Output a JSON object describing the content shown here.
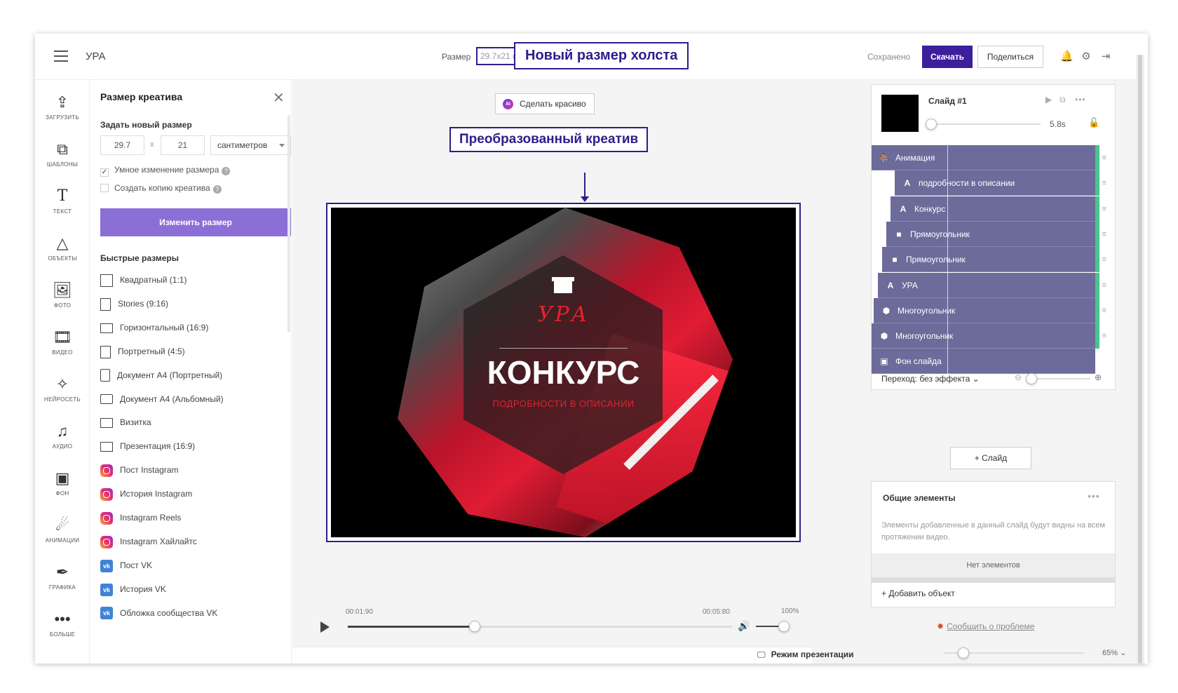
{
  "header": {
    "app_name": "УРА",
    "size_label": "Размер",
    "size_value": "29.7x21 cm",
    "saved": "Сохранено",
    "download": "Скачать",
    "share": "Поделиться",
    "icons": [
      "bell-icon",
      "gear-icon",
      "exit-icon"
    ]
  },
  "annotations": {
    "new_canvas_size": "Новый размер холста",
    "transformed_creative": "Преобразованный креатив",
    "color": "#2d1d8c"
  },
  "toolbar": {
    "items": [
      {
        "label": "ЗАГРУЗИТЬ",
        "icon": "upload-icon"
      },
      {
        "label": "ШАБЛОНЫ",
        "icon": "templates-icon"
      },
      {
        "label": "ТЕКСТ",
        "icon": "text-icon"
      },
      {
        "label": "ОБЪЕКТЫ",
        "icon": "shapes-icon"
      },
      {
        "label": "ФОТО",
        "icon": "photo-icon"
      },
      {
        "label": "ВИДЕО",
        "icon": "video-icon"
      },
      {
        "label": "НЕЙРОСЕТЬ",
        "icon": "magic-wand-icon"
      },
      {
        "label": "АУДИО",
        "icon": "music-icon"
      },
      {
        "label": "ФОН",
        "icon": "background-icon"
      },
      {
        "label": "АНИМАЦИИ",
        "icon": "animation-icon"
      },
      {
        "label": "ГРАФИКА",
        "icon": "brush-icon"
      },
      {
        "label": "БОЛЬШЕ",
        "icon": "more-icon"
      }
    ]
  },
  "size_panel": {
    "title": "Размер креатива",
    "subtitle": "Задать новый размер",
    "width": "29.7",
    "times": "x",
    "height": "21",
    "unit": "сантиметров",
    "smart_resize": "Умное изменение размера",
    "make_copy": "Создать копию креатива",
    "resize_button": "Изменить размер",
    "quick_title": "Быстрые размеры",
    "quick_sizes": [
      {
        "label": "Квадратный (1:1)",
        "icon": "square"
      },
      {
        "label": "Stories (9:16)",
        "icon": "portrait"
      },
      {
        "label": "Горизонтальный (16:9)",
        "icon": "landscape"
      },
      {
        "label": "Портретный (4:5)",
        "icon": "portrait"
      },
      {
        "label": "Документ А4 (Портретный)",
        "icon": "doc"
      },
      {
        "label": "Документ А4 (Альбомный)",
        "icon": "doc-land"
      },
      {
        "label": "Визитка",
        "icon": "card"
      },
      {
        "label": "Презентация (16:9)",
        "icon": "presentation"
      },
      {
        "label": "Пост Instagram",
        "icon": "instagram"
      },
      {
        "label": "История Instagram",
        "icon": "instagram"
      },
      {
        "label": "Instagram Reels",
        "icon": "instagram"
      },
      {
        "label": "Instagram Хайлайтс",
        "icon": "instagram"
      },
      {
        "label": "Пост VK",
        "icon": "vk"
      },
      {
        "label": "История VK",
        "icon": "vk"
      },
      {
        "label": "Обложка сообщества VK",
        "icon": "vk"
      }
    ]
  },
  "canvas": {
    "beautify_button": "Сделать красиво",
    "ai_badge": "AI",
    "logo_text": "УРА",
    "title": "КОНКУРС",
    "subtitle": "ПОДРОБНОСТИ В ОПИСАНИИ"
  },
  "playback": {
    "current_time": "00:01:90",
    "total_time": "00:05:80",
    "volume": "100%",
    "progress": 0.33,
    "presentation_mode": "Режим презентации",
    "zoom": "65% ⌄"
  },
  "slide": {
    "name": "Слайд #1",
    "duration": "5.8s",
    "layers": [
      {
        "label": "Анимация",
        "icon": "run-icon",
        "glyph": "⛹"
      },
      {
        "label": "подробности в описании",
        "icon": "text-layer-icon",
        "glyph": "A"
      },
      {
        "label": "Конкурс",
        "icon": "text-layer-icon",
        "glyph": "A"
      },
      {
        "label": "Прямоугольник",
        "icon": "rectangle-icon",
        "glyph": "■"
      },
      {
        "label": "Прямоугольник",
        "icon": "rectangle-icon",
        "glyph": "■"
      },
      {
        "label": "УРА",
        "icon": "text-layer-icon",
        "glyph": "A"
      },
      {
        "label": "Многоугольник",
        "icon": "polygon-icon",
        "glyph": "⬢"
      },
      {
        "label": "Многоугольник",
        "icon": "polygon-icon",
        "glyph": "⬢"
      },
      {
        "label": "Фон слайда",
        "icon": "background-layer-icon",
        "glyph": "▣"
      }
    ],
    "transition": "Переход: без эффекта ⌄"
  },
  "right": {
    "add_slide": "+ Слайд",
    "common_title": "Общие элементы",
    "common_desc": "Элементы добавленные в данный слайд будут видны на всем протяжении видео.",
    "no_elements": "Нет элементов",
    "add_object": "+ Добавить объект",
    "report": "Сообщить о проблеме"
  }
}
